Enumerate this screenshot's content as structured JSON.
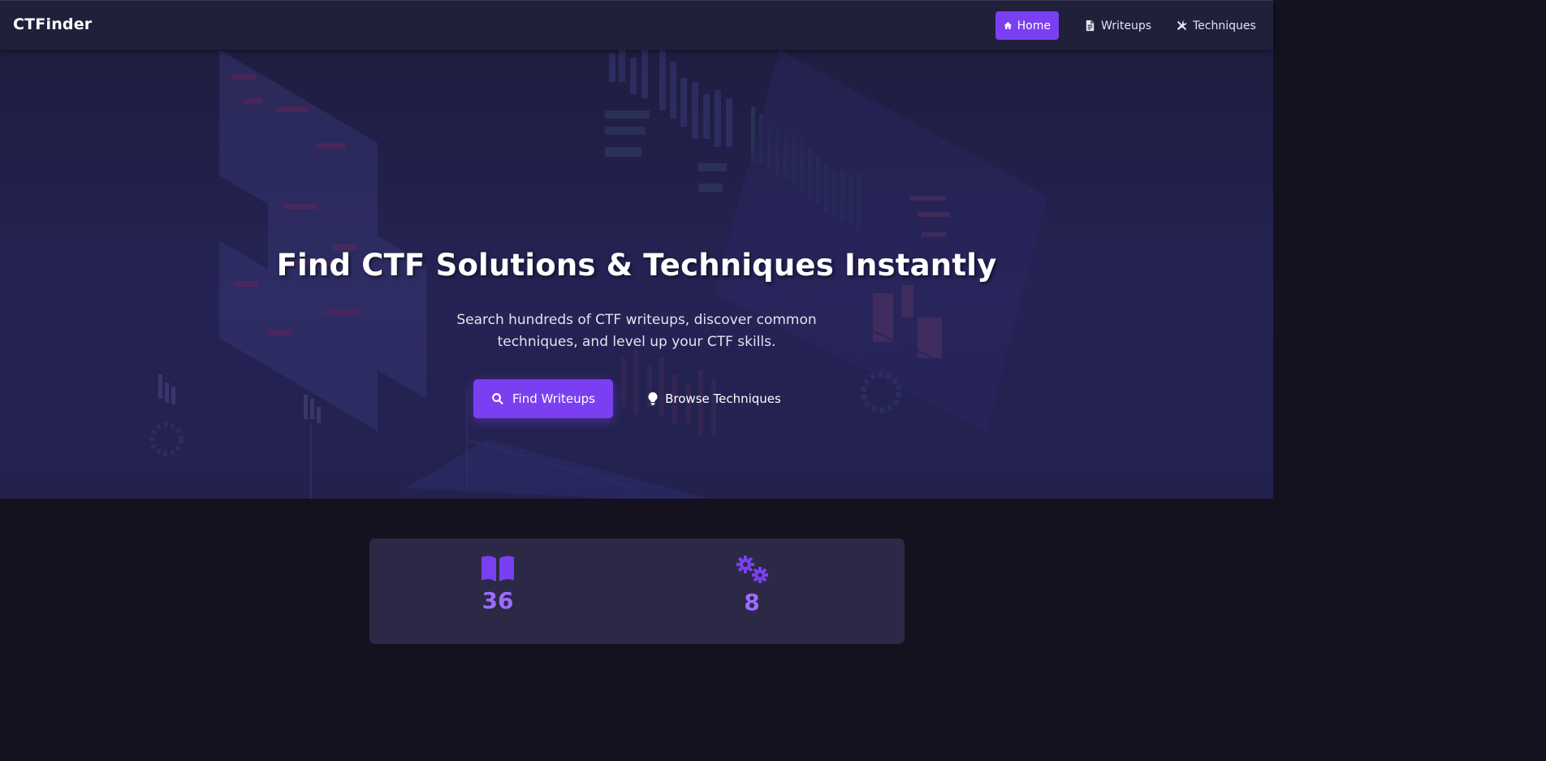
{
  "navbar": {
    "brand": "CTFinder",
    "links": [
      {
        "label": "Home",
        "icon": "home-icon",
        "active": true
      },
      {
        "label": "Writeups",
        "icon": "file-icon",
        "active": false
      },
      {
        "label": "Techniques",
        "icon": "tools-icon",
        "active": false
      }
    ]
  },
  "hero": {
    "title": "Find CTF Solutions & Techniques Instantly",
    "subtitle": "Search hundreds of CTF writeups, discover common techniques, and level up your CTF skills.",
    "primary_button": {
      "label": "Find Writeups",
      "icon": "search-icon"
    },
    "secondary_button": {
      "label": "Browse Techniques",
      "icon": "lightbulb-icon"
    }
  },
  "stats": [
    {
      "value": "36",
      "icon": "book-open-icon"
    },
    {
      "value": "8",
      "icon": "gears-icon"
    }
  ],
  "colors": {
    "accent": "#7b3ff2",
    "navbar_bg": "#21203a",
    "hero_bg": "#252354",
    "page_bg": "#13121e",
    "card_bg": "#2b2945",
    "stat_value": "#9d6bff"
  }
}
